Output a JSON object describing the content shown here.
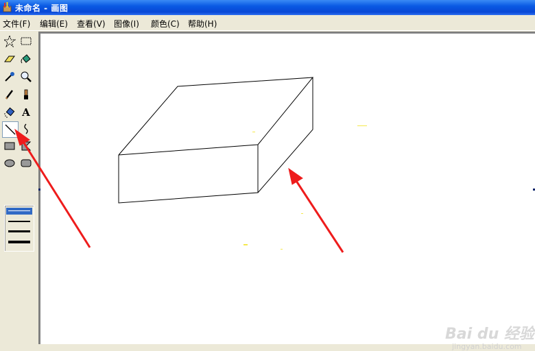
{
  "window": {
    "title": "未命名 - 画图"
  },
  "menu": [
    "文件(F)",
    "编辑(E)",
    "查看(V)",
    "图像(I)",
    "颜色(C)",
    "帮助(H)"
  ],
  "tools": [
    {
      "name": "free-select-tool",
      "icon": "star-select-icon"
    },
    {
      "name": "rect-select-tool",
      "icon": "rect-select-icon"
    },
    {
      "name": "eraser-tool",
      "icon": "eraser-icon"
    },
    {
      "name": "fill-tool",
      "icon": "paint-bucket-icon"
    },
    {
      "name": "color-picker-tool",
      "icon": "eyedropper-icon"
    },
    {
      "name": "magnifier-tool",
      "icon": "magnifier-icon"
    },
    {
      "name": "pencil-tool",
      "icon": "pencil-icon"
    },
    {
      "name": "brush-tool",
      "icon": "brush-icon"
    },
    {
      "name": "airbrush-tool",
      "icon": "airbrush-icon"
    },
    {
      "name": "text-tool",
      "icon": "text-icon",
      "label": "A"
    },
    {
      "name": "line-tool",
      "icon": "line-icon",
      "selected": true
    },
    {
      "name": "curve-tool",
      "icon": "curve-icon"
    },
    {
      "name": "rectangle-tool",
      "icon": "rectangle-icon"
    },
    {
      "name": "polygon-tool",
      "icon": "polygon-icon"
    },
    {
      "name": "ellipse-tool",
      "icon": "ellipse-icon"
    },
    {
      "name": "rounded-rect-tool",
      "icon": "rounded-rect-icon"
    }
  ],
  "line_widths": [
    1,
    2,
    3,
    4
  ],
  "selected_line_width": 1,
  "colors": {
    "arrow": "#ee1c1c",
    "titlebar": "#0a5ae3",
    "stroke": "#000000"
  },
  "watermark": {
    "brand": "Bai du 经验",
    "url": "jingyan.baidu.com"
  }
}
